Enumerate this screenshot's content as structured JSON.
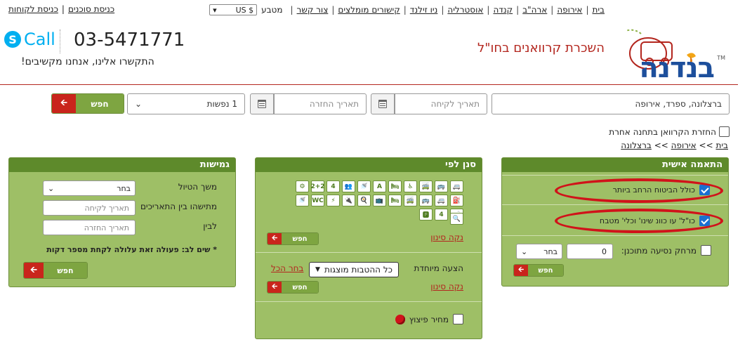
{
  "topnav": {
    "links": [
      "בית",
      "אירופה",
      "ארה\"ב",
      "קנדה",
      "אוסטרליה",
      "ניו זילנד",
      "קישורים מומלצים",
      "צור קשר"
    ],
    "currency_label": "מטבע",
    "currency_value": "US $",
    "agent_login": "כניסת סוכנים",
    "customer_login": "כניסת לקוחות"
  },
  "brand": {
    "logo_text": "בנדנה",
    "tm": "TM",
    "tagline": "השכרת קרוואנים בחו\"ל"
  },
  "contact": {
    "skype_letter": "S",
    "skype_label": "Call",
    "phone": "03-5471771",
    "note": "התקשרו אלינו, אנחנו מקשיבים!"
  },
  "search": {
    "location": "ברצלונה, ספרד, אירופה",
    "pickup_placeholder": "תאריך לקיחה",
    "return_placeholder": "תאריך החזרה",
    "passengers": "1 נפשות",
    "search_label": "חפש",
    "return_other_station": "החזרת הקרוואן בתחנה אחרת"
  },
  "breadcrumb": {
    "items": [
      "בית",
      "אירופה",
      "ברצלונה"
    ],
    "sep": ">>"
  },
  "personal": {
    "title": "התאמה אישית",
    "opt1": "כולל הביטוח הרחב ביותר",
    "opt2": "כו\"ל' עו כוונ שינו' וכלי' מטבח",
    "distance_label": "מרחק נסיעה מתוכנן:",
    "distance_value": "0",
    "distance_select": "בחר",
    "search_label": "חפש"
  },
  "filter": {
    "title": "סנן לפי",
    "clear": "נקה סינון",
    "search_label": "חפש",
    "special_label": "הצעה מיוחדת",
    "special_value": "כל ההטבות מוצגות",
    "select_all": "בחר הכל",
    "clear2": "נקה סינון",
    "price_label": "מחיר פיצוץ",
    "icons": [
      "🚐",
      "🚌",
      "🚎",
      "♿",
      "🛏",
      "A",
      "🚿",
      "👥",
      "4",
      "2+2",
      "⚙",
      "⛽",
      "🚐",
      "🚌",
      "🚎",
      "🛏",
      "📺",
      "🍳",
      "🔌",
      "⚡",
      "WC",
      "🚿",
      "🛁",
      "4",
      "🅿",
      "🔍"
    ]
  },
  "flex": {
    "title": "גמישות",
    "trip_length_label": "משך הטיול",
    "trip_length_select": "בחר",
    "start_between_label": "מתישהו בין התאריכים",
    "start_placeholder": "תאריך לקיחה",
    "and_label": "לבין",
    "end_placeholder": "תאריך החזרה",
    "note": "* שים לב: פעולה זאת עלולה לקחת מספר דקות",
    "search_label": "חפש"
  }
}
